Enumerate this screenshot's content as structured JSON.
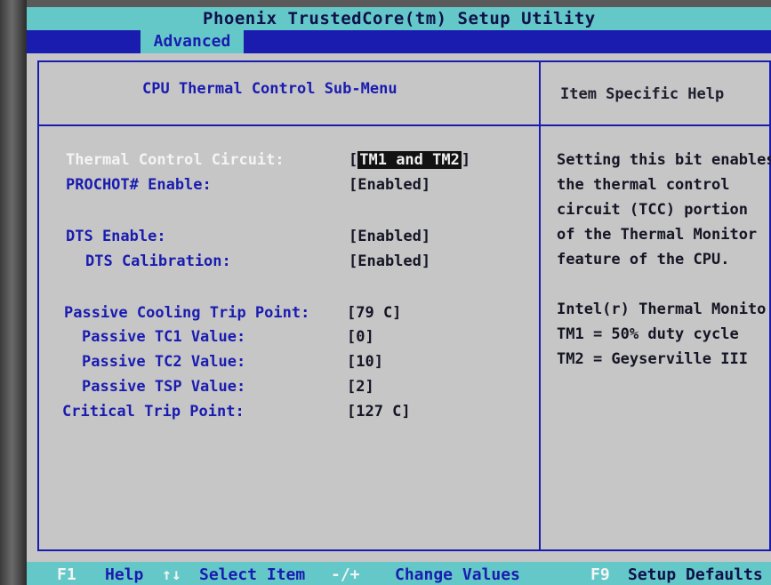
{
  "header": {
    "title": "Phoenix TrustedCore(tm) Setup Utility",
    "active_tab": "Advanced"
  },
  "panel": {
    "left_title": "CPU Thermal Control Sub-Menu",
    "right_title": "Item Specific Help"
  },
  "settings": [
    {
      "label": "Thermal Control Circuit:",
      "value": "TM1 and TM2"
    },
    {
      "label": "PROCHOT# Enable:",
      "value": "[Enabled]"
    },
    {
      "label": "DTS Enable:",
      "value": "[Enabled]"
    },
    {
      "label": "DTS Calibration:",
      "value": "[Enabled]"
    },
    {
      "label": "Passive Cooling Trip Point:",
      "value": "[79  C]"
    },
    {
      "label": "Passive TC1 Value:",
      "value": "[0]"
    },
    {
      "label": "Passive TC2 Value:",
      "value": "[10]"
    },
    {
      "label": "Passive TSP Value:",
      "value": "[2]"
    },
    {
      "label": "Critical Trip Point:",
      "value": "[127 C]"
    }
  ],
  "help_text": [
    "Setting this bit enables",
    "the thermal control",
    "circuit (TCC) portion",
    "of the Thermal Monitor",
    "feature of the CPU.",
    "Intel(r) Thermal Monito",
    "TM1 = 50% duty cycle",
    "TM2 = Geyserville III"
  ],
  "footer": {
    "f1_key": "F1",
    "help": "Help",
    "arrows_key": "↑↓",
    "select_item": "Select Item",
    "change_key": "-/+",
    "change_values": "Change Values",
    "f9_key": "F9",
    "setup_defaults": "Setup Defaults"
  },
  "colors": {
    "title_bar": "#64c8c8",
    "menu_bar": "#1a1cb0",
    "panel_bg": "#c6c6c6",
    "label_text": "#1a1cb0",
    "selected_label": "#f4f4f4"
  }
}
